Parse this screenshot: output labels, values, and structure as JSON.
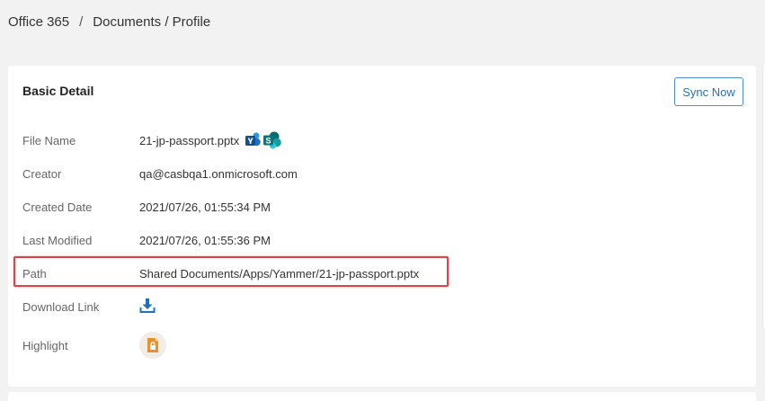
{
  "breadcrumb": {
    "items": [
      "Office 365",
      "Documents / Profile"
    ],
    "separator": "/"
  },
  "card": {
    "title": "Basic Detail",
    "sync_label": "Sync Now"
  },
  "details": {
    "file_name": {
      "label": "File Name",
      "value": "21-jp-passport.pptx"
    },
    "creator": {
      "label": "Creator",
      "value": "qa@casbqa1.onmicrosoft.com"
    },
    "created_date": {
      "label": "Created Date",
      "value": "2021/07/26, 01:55:34 PM"
    },
    "last_modified": {
      "label": "Last Modified",
      "value": "2021/07/26, 01:55:36 PM"
    },
    "path": {
      "label": "Path",
      "value": "Shared Documents/Apps/Yammer/21-jp-passport.pptx"
    },
    "download_link": {
      "label": "Download Link"
    },
    "highlight": {
      "label": "Highlight"
    }
  },
  "icons": {
    "app_icons": [
      "yammer-icon",
      "sharepoint-icon"
    ],
    "download": "download-icon",
    "highlight": "lock-file-icon"
  },
  "colors": {
    "accent": "#2a6fb0",
    "highlight_border": "#d9454a",
    "lock_orange": "#e8902a"
  }
}
